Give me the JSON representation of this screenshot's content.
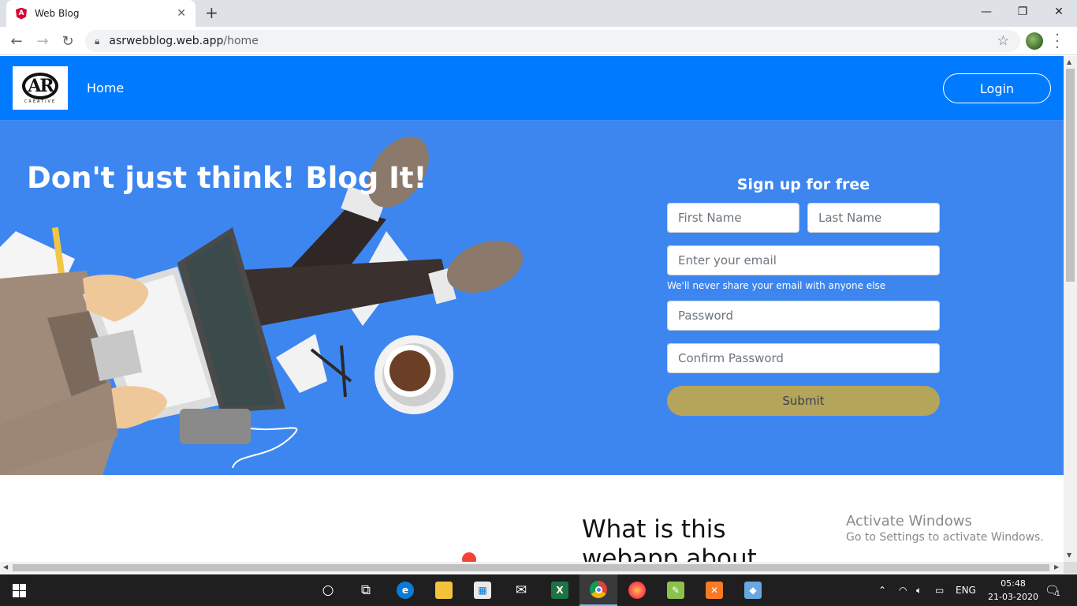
{
  "browser": {
    "tab_title": "Web Blog",
    "tab_close": "✕",
    "new_tab": "+",
    "url_host": "asrwebblog.web.app",
    "url_path": "/home",
    "win_minimize": "—",
    "win_restore": "❐",
    "win_close": "✕"
  },
  "site": {
    "logo_text": "AR",
    "logo_sub": "CREATIVE",
    "nav_home": "Home",
    "login": "Login"
  },
  "hero": {
    "title": "Don't just think! Blog It!"
  },
  "signup": {
    "title": "Sign up for free",
    "first_name_placeholder": "First Name",
    "last_name_placeholder": "Last Name",
    "email_placeholder": "Enter your email",
    "email_hint": "We'll never share your email with anyone else",
    "password_placeholder": "Password",
    "confirm_placeholder": "Confirm Password",
    "submit": "Submit"
  },
  "about": {
    "title": "What is this webapp about"
  },
  "watermark": {
    "line1": "Activate Windows",
    "line2": "Go to Settings to activate Windows."
  },
  "taskbar": {
    "language": "ENG",
    "time": "05:48",
    "date": "21-03-2020",
    "notifications": "1"
  },
  "colors": {
    "navbar": "#007bff",
    "hero": "#3d86f0",
    "submit": "#b5a55a"
  }
}
